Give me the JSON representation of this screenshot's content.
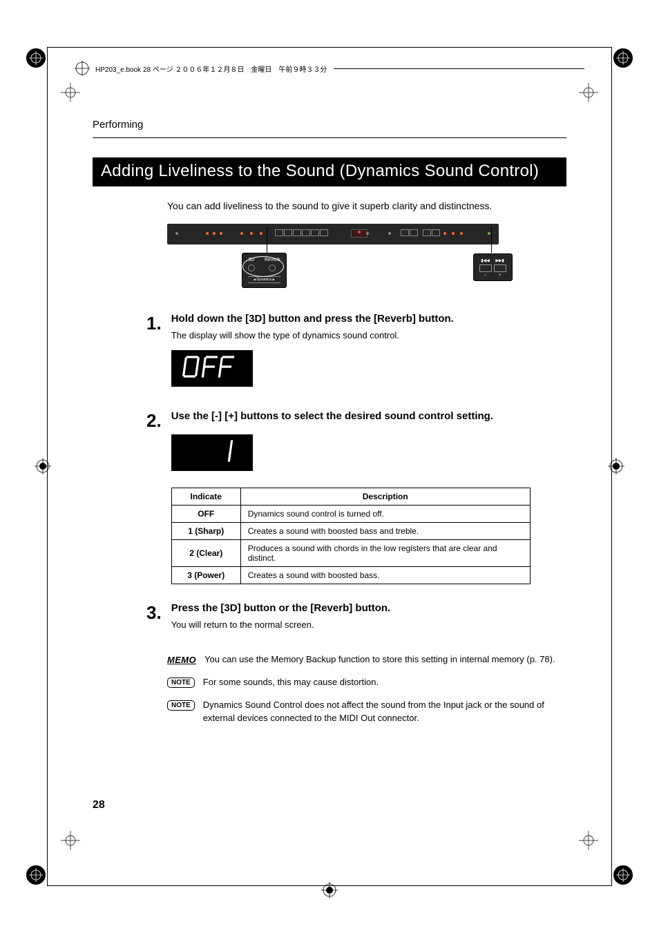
{
  "header": {
    "filemeta": "HP203_e.book 28 ページ ２００６年１２月８日　金曜日　午前９時３３分"
  },
  "page": {
    "running_head": "Performing",
    "section_title": "Adding Liveliness to the Sound (Dynamics Sound Control)",
    "intro": "You can add liveliness to the sound to give it superb clarity and distinctness.",
    "page_number": "28"
  },
  "figure": {
    "callout_left": {
      "label_3d": "3D",
      "label_reverb": "Reverb",
      "label_dynamics": "Dynamics"
    },
    "callout_right": {
      "btn_prev": "▮◀◀",
      "btn_next": "▶▶▮",
      "label_minus": "−",
      "label_plus": "+"
    }
  },
  "steps": [
    {
      "num": "1",
      "dot": ".",
      "title": "Hold down the [3D] button and press the [Reverb] button.",
      "text": "The display will show the type of dynamics sound control.",
      "lcd": "OFF"
    },
    {
      "num": "2",
      "dot": ".",
      "title": "Use the [-] [+] buttons to select the desired sound control setting.",
      "lcd": "  1"
    },
    {
      "num": "3",
      "dot": ".",
      "title": "Press the [3D] button or the [Reverb] button.",
      "text": "You will return to the normal screen."
    }
  ],
  "table": {
    "headers": {
      "indicate": "Indicate",
      "description": "Description"
    },
    "rows": [
      {
        "indicate": "OFF",
        "description": "Dynamics sound control is turned off."
      },
      {
        "indicate": "1 (Sharp)",
        "description": "Creates a sound with boosted bass and treble."
      },
      {
        "indicate": "2 (Clear)",
        "description": "Produces a sound with chords in the low registers that are clear and distinct."
      },
      {
        "indicate": "3 (Power)",
        "description": "Creates a sound with boosted bass."
      }
    ]
  },
  "notes": {
    "memo_label": "MEMO",
    "memo_text": "You can use the Memory Backup function to store this setting in internal memory (p. 78).",
    "note1_label": "NOTE",
    "note1_text": "For some sounds, this may cause distortion.",
    "note2_label": "NOTE",
    "note2_text": "Dynamics Sound Control does not affect the sound from the Input jack or the sound of external devices connected to the MIDI Out connector."
  }
}
